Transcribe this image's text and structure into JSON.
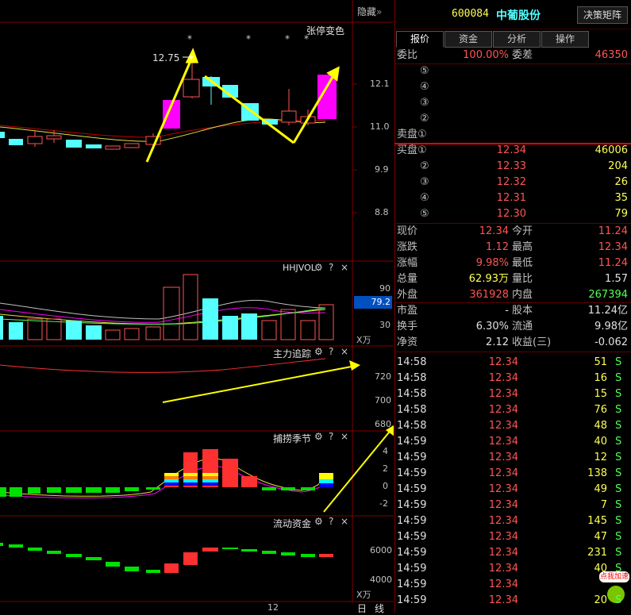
{
  "topbar": {
    "hide_label": "隐藏",
    "hide_icon": "chevron-double-right-icon"
  },
  "main_chart": {
    "title": "张停变色",
    "high_label": "12.75",
    "y_ticks": [
      "12.1",
      "11.0",
      "9.9",
      "8.8"
    ],
    "stars": [
      "*",
      "*",
      "*",
      "*"
    ]
  },
  "vol_panel": {
    "title": "HHJVOL",
    "y_ticks": [
      "90",
      "30"
    ],
    "unit": "X万",
    "current_value": "79.2"
  },
  "track_panel": {
    "title": "主力追踪",
    "y_ticks": [
      "720",
      "700",
      "680"
    ]
  },
  "season_panel": {
    "title": "捕捞季节",
    "y_ticks": [
      "4",
      "2",
      "0",
      "-2"
    ]
  },
  "flow_panel": {
    "title": "流动资金",
    "y_ticks": [
      "6000",
      "4000"
    ],
    "unit": "X万"
  },
  "x_axis": {
    "label": "12"
  },
  "period_tabs": [
    "日",
    "线"
  ],
  "panel_icons": {
    "gear": "gear-icon",
    "help": "?",
    "close": "×"
  },
  "stock": {
    "code": "600084",
    "name": "中葡股份",
    "decision_button": "决策矩阵"
  },
  "tabs": [
    "报价",
    "资金",
    "分析",
    "操作"
  ],
  "weibi": {
    "label": "委比",
    "value": "100.00%",
    "diff_label": "委差",
    "diff_value": "46350"
  },
  "sell_levels": [
    {
      "label": "⑤",
      "price": "",
      "vol": ""
    },
    {
      "label": "④",
      "price": "",
      "vol": ""
    },
    {
      "label": "③",
      "price": "",
      "vol": ""
    },
    {
      "label": "②",
      "price": "",
      "vol": ""
    },
    {
      "label": "卖盘①",
      "price": "",
      "vol": ""
    }
  ],
  "buy_levels": [
    {
      "label": "买盘①",
      "price": "12.34",
      "vol": "46006"
    },
    {
      "label": "②",
      "price": "12.33",
      "vol": "204"
    },
    {
      "label": "③",
      "price": "12.32",
      "vol": "26"
    },
    {
      "label": "④",
      "price": "12.31",
      "vol": "35"
    },
    {
      "label": "⑤",
      "price": "12.30",
      "vol": "79"
    }
  ],
  "quote": [
    {
      "l1": "现价",
      "v1": "12.34",
      "l2": "今开",
      "v2": "11.24",
      "c1": "red",
      "c2": "red"
    },
    {
      "l1": "涨跌",
      "v1": "1.12",
      "l2": "最高",
      "v2": "12.34",
      "c1": "red",
      "c2": "red"
    },
    {
      "l1": "涨幅",
      "v1": "9.98%",
      "l2": "最低",
      "v2": "11.24",
      "c1": "red",
      "c2": "red"
    },
    {
      "l1": "总量",
      "v1": "62.93万",
      "l2": "量比",
      "v2": "1.57",
      "c1": "yel",
      "c2": "wht"
    },
    {
      "l1": "外盘",
      "v1": "361928",
      "l2": "内盘",
      "v2": "267394",
      "c1": "red",
      "c2": "grn"
    }
  ],
  "finance": [
    {
      "l1": "市盈",
      "v1": "-",
      "l2": "股本",
      "v2": "11.24亿"
    },
    {
      "l1": "换手",
      "v1": "6.30%",
      "l2": "流通",
      "v2": "9.98亿"
    },
    {
      "l1": "净资",
      "v1": "2.12",
      "l2": "收益(三)",
      "v2": "-0.062"
    }
  ],
  "ticks": [
    {
      "time": "14:58",
      "price": "12.34",
      "vol": "51",
      "side": "S"
    },
    {
      "time": "14:58",
      "price": "12.34",
      "vol": "16",
      "side": "S"
    },
    {
      "time": "14:58",
      "price": "12.34",
      "vol": "15",
      "side": "S"
    },
    {
      "time": "14:58",
      "price": "12.34",
      "vol": "76",
      "side": "S"
    },
    {
      "time": "14:58",
      "price": "12.34",
      "vol": "48",
      "side": "S"
    },
    {
      "time": "14:59",
      "price": "12.34",
      "vol": "40",
      "side": "S"
    },
    {
      "time": "14:59",
      "price": "12.34",
      "vol": "12",
      "side": "S"
    },
    {
      "time": "14:59",
      "price": "12.34",
      "vol": "138",
      "side": "S"
    },
    {
      "time": "14:59",
      "price": "12.34",
      "vol": "49",
      "side": "S"
    },
    {
      "time": "14:59",
      "price": "12.34",
      "vol": "7",
      "side": "S"
    },
    {
      "time": "14:59",
      "price": "12.34",
      "vol": "145",
      "side": "S"
    },
    {
      "time": "14:59",
      "price": "12.34",
      "vol": "47",
      "side": "S"
    },
    {
      "time": "14:59",
      "price": "12.34",
      "vol": "231",
      "side": "S"
    },
    {
      "time": "14:59",
      "price": "12.34",
      "vol": "40",
      "side": "S"
    },
    {
      "time": "14:59",
      "price": "12.34",
      "vol": "",
      "side": ""
    },
    {
      "time": "14:59",
      "price": "12.34",
      "vol": "20",
      "side": "S"
    }
  ],
  "badge": {
    "text": "点我加速",
    "icon": "speed-badge-icon"
  },
  "colors": {
    "up": "#ff5454",
    "down": "#54ffff",
    "arrow": "#ffff00",
    "grid": "#800000"
  }
}
